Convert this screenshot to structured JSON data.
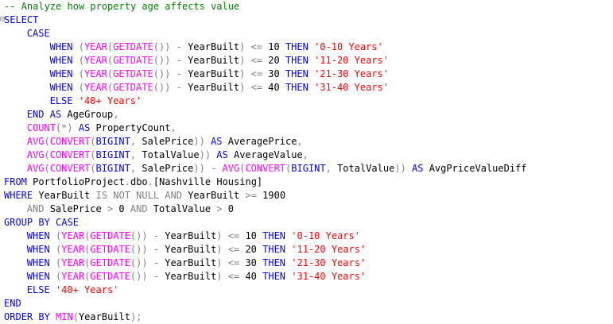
{
  "editor": {
    "language": "SQL",
    "colors": {
      "keyword": "#0000ff",
      "function": "#ff00ff",
      "string": "#ff0000",
      "comment": "#008000",
      "operator": "#808080",
      "identifier": "#000000"
    },
    "lines": [
      {
        "indent": 0,
        "tokens": [
          {
            "t": "cmt",
            "v": "-- Analyze how property age affects value"
          }
        ]
      },
      {
        "indent": 0,
        "collapse": true,
        "tokens": [
          {
            "t": "kw",
            "v": "SELECT"
          }
        ]
      },
      {
        "indent": 4,
        "tokens": [
          {
            "t": "kw",
            "v": "CASE"
          }
        ]
      },
      {
        "indent": 8,
        "tokens": [
          {
            "t": "kw",
            "v": "WHEN"
          },
          {
            "t": "id",
            "v": " "
          },
          {
            "t": "op",
            "v": "("
          },
          {
            "t": "fn",
            "v": "YEAR"
          },
          {
            "t": "op",
            "v": "("
          },
          {
            "t": "fn",
            "v": "GETDATE"
          },
          {
            "t": "op",
            "v": "())"
          },
          {
            "t": "id",
            "v": " "
          },
          {
            "t": "op",
            "v": "-"
          },
          {
            "t": "id",
            "v": " YearBuilt"
          },
          {
            "t": "op",
            "v": ")"
          },
          {
            "t": "id",
            "v": " "
          },
          {
            "t": "op",
            "v": "<="
          },
          {
            "t": "id",
            "v": " 10 "
          },
          {
            "t": "kw",
            "v": "THEN"
          },
          {
            "t": "id",
            "v": " "
          },
          {
            "t": "str",
            "v": "'0-10 Years'"
          }
        ]
      },
      {
        "indent": 8,
        "tokens": [
          {
            "t": "kw",
            "v": "WHEN"
          },
          {
            "t": "id",
            "v": " "
          },
          {
            "t": "op",
            "v": "("
          },
          {
            "t": "fn",
            "v": "YEAR"
          },
          {
            "t": "op",
            "v": "("
          },
          {
            "t": "fn",
            "v": "GETDATE"
          },
          {
            "t": "op",
            "v": "())"
          },
          {
            "t": "id",
            "v": " "
          },
          {
            "t": "op",
            "v": "-"
          },
          {
            "t": "id",
            "v": " YearBuilt"
          },
          {
            "t": "op",
            "v": ")"
          },
          {
            "t": "id",
            "v": " "
          },
          {
            "t": "op",
            "v": "<="
          },
          {
            "t": "id",
            "v": " 20 "
          },
          {
            "t": "kw",
            "v": "THEN"
          },
          {
            "t": "id",
            "v": " "
          },
          {
            "t": "str",
            "v": "'11-20 Years'"
          }
        ]
      },
      {
        "indent": 8,
        "tokens": [
          {
            "t": "kw",
            "v": "WHEN"
          },
          {
            "t": "id",
            "v": " "
          },
          {
            "t": "op",
            "v": "("
          },
          {
            "t": "fn",
            "v": "YEAR"
          },
          {
            "t": "op",
            "v": "("
          },
          {
            "t": "fn",
            "v": "GETDATE"
          },
          {
            "t": "op",
            "v": "())"
          },
          {
            "t": "id",
            "v": " "
          },
          {
            "t": "op",
            "v": "-"
          },
          {
            "t": "id",
            "v": " YearBuilt"
          },
          {
            "t": "op",
            "v": ")"
          },
          {
            "t": "id",
            "v": " "
          },
          {
            "t": "op",
            "v": "<="
          },
          {
            "t": "id",
            "v": " 30 "
          },
          {
            "t": "kw",
            "v": "THEN"
          },
          {
            "t": "id",
            "v": " "
          },
          {
            "t": "str",
            "v": "'21-30 Years'"
          }
        ]
      },
      {
        "indent": 8,
        "tokens": [
          {
            "t": "kw",
            "v": "WHEN"
          },
          {
            "t": "id",
            "v": " "
          },
          {
            "t": "op",
            "v": "("
          },
          {
            "t": "fn",
            "v": "YEAR"
          },
          {
            "t": "op",
            "v": "("
          },
          {
            "t": "fn",
            "v": "GETDATE"
          },
          {
            "t": "op",
            "v": "())"
          },
          {
            "t": "id",
            "v": " "
          },
          {
            "t": "op",
            "v": "-"
          },
          {
            "t": "id",
            "v": " YearBuilt"
          },
          {
            "t": "op",
            "v": ")"
          },
          {
            "t": "id",
            "v": " "
          },
          {
            "t": "op",
            "v": "<="
          },
          {
            "t": "id",
            "v": " 40 "
          },
          {
            "t": "kw",
            "v": "THEN"
          },
          {
            "t": "id",
            "v": " "
          },
          {
            "t": "str",
            "v": "'31-40 Years'"
          }
        ]
      },
      {
        "indent": 8,
        "tokens": [
          {
            "t": "kw",
            "v": "ELSE"
          },
          {
            "t": "id",
            "v": " "
          },
          {
            "t": "str",
            "v": "'40+ Years'"
          }
        ]
      },
      {
        "indent": 4,
        "tokens": [
          {
            "t": "kw",
            "v": "END"
          },
          {
            "t": "id",
            "v": " "
          },
          {
            "t": "kw",
            "v": "AS"
          },
          {
            "t": "id",
            "v": " AgeGroup"
          },
          {
            "t": "op",
            "v": ","
          }
        ]
      },
      {
        "indent": 4,
        "tokens": [
          {
            "t": "fn",
            "v": "COUNT"
          },
          {
            "t": "op",
            "v": "(*)"
          },
          {
            "t": "id",
            "v": " "
          },
          {
            "t": "kw",
            "v": "AS"
          },
          {
            "t": "id",
            "v": " PropertyCount"
          },
          {
            "t": "op",
            "v": ","
          }
        ]
      },
      {
        "indent": 4,
        "tokens": [
          {
            "t": "fn",
            "v": "AVG"
          },
          {
            "t": "op",
            "v": "("
          },
          {
            "t": "fn",
            "v": "CONVERT"
          },
          {
            "t": "op",
            "v": "("
          },
          {
            "t": "kw",
            "v": "BIGINT"
          },
          {
            "t": "op",
            "v": ","
          },
          {
            "t": "id",
            "v": " SalePrice"
          },
          {
            "t": "op",
            "v": "))"
          },
          {
            "t": "id",
            "v": " "
          },
          {
            "t": "kw",
            "v": "AS"
          },
          {
            "t": "id",
            "v": " AveragePrice"
          },
          {
            "t": "op",
            "v": ","
          }
        ]
      },
      {
        "indent": 4,
        "tokens": [
          {
            "t": "fn",
            "v": "AVG"
          },
          {
            "t": "op",
            "v": "("
          },
          {
            "t": "fn",
            "v": "CONVERT"
          },
          {
            "t": "op",
            "v": "("
          },
          {
            "t": "kw",
            "v": "BIGINT"
          },
          {
            "t": "op",
            "v": ","
          },
          {
            "t": "id",
            "v": " TotalValue"
          },
          {
            "t": "op",
            "v": "))"
          },
          {
            "t": "id",
            "v": " "
          },
          {
            "t": "kw",
            "v": "AS"
          },
          {
            "t": "id",
            "v": " AverageValue"
          },
          {
            "t": "op",
            "v": ","
          }
        ]
      },
      {
        "indent": 4,
        "tokens": [
          {
            "t": "fn",
            "v": "AVG"
          },
          {
            "t": "op",
            "v": "("
          },
          {
            "t": "fn",
            "v": "CONVERT"
          },
          {
            "t": "op",
            "v": "("
          },
          {
            "t": "kw",
            "v": "BIGINT"
          },
          {
            "t": "op",
            "v": ","
          },
          {
            "t": "id",
            "v": " SalePrice"
          },
          {
            "t": "op",
            "v": "))"
          },
          {
            "t": "id",
            "v": " "
          },
          {
            "t": "op",
            "v": "-"
          },
          {
            "t": "id",
            "v": " "
          },
          {
            "t": "fn",
            "v": "AVG"
          },
          {
            "t": "op",
            "v": "("
          },
          {
            "t": "fn",
            "v": "CONVERT"
          },
          {
            "t": "op",
            "v": "("
          },
          {
            "t": "kw",
            "v": "BIGINT"
          },
          {
            "t": "op",
            "v": ","
          },
          {
            "t": "id",
            "v": " TotalValue"
          },
          {
            "t": "op",
            "v": "))"
          },
          {
            "t": "id",
            "v": " "
          },
          {
            "t": "kw",
            "v": "AS"
          },
          {
            "t": "id",
            "v": " AvgPriceValueDiff"
          }
        ]
      },
      {
        "indent": 0,
        "tokens": [
          {
            "t": "kw",
            "v": "FROM"
          },
          {
            "t": "id",
            "v": " PortfolioProject"
          },
          {
            "t": "op",
            "v": "."
          },
          {
            "t": "id",
            "v": "dbo"
          },
          {
            "t": "op",
            "v": "."
          },
          {
            "t": "id",
            "v": "[Nashville Housing]"
          }
        ]
      },
      {
        "indent": 0,
        "tokens": [
          {
            "t": "kw",
            "v": "WHERE"
          },
          {
            "t": "id",
            "v": " YearBuilt "
          },
          {
            "t": "op",
            "v": "IS NOT NULL AND"
          },
          {
            "t": "id",
            "v": " YearBuilt "
          },
          {
            "t": "op",
            "v": ">="
          },
          {
            "t": "id",
            "v": " 1900"
          }
        ]
      },
      {
        "indent": 4,
        "tokens": [
          {
            "t": "op",
            "v": "AND"
          },
          {
            "t": "id",
            "v": " SalePrice "
          },
          {
            "t": "op",
            "v": ">"
          },
          {
            "t": "id",
            "v": " 0 "
          },
          {
            "t": "op",
            "v": "AND"
          },
          {
            "t": "id",
            "v": " TotalValue "
          },
          {
            "t": "op",
            "v": ">"
          },
          {
            "t": "id",
            "v": " 0"
          }
        ]
      },
      {
        "indent": 0,
        "tokens": [
          {
            "t": "kw",
            "v": "GROUP BY CASE"
          }
        ]
      },
      {
        "indent": 4,
        "tokens": [
          {
            "t": "kw",
            "v": "WHEN"
          },
          {
            "t": "id",
            "v": " "
          },
          {
            "t": "op",
            "v": "("
          },
          {
            "t": "fn",
            "v": "YEAR"
          },
          {
            "t": "op",
            "v": "("
          },
          {
            "t": "fn",
            "v": "GETDATE"
          },
          {
            "t": "op",
            "v": "())"
          },
          {
            "t": "id",
            "v": " "
          },
          {
            "t": "op",
            "v": "-"
          },
          {
            "t": "id",
            "v": " YearBuilt"
          },
          {
            "t": "op",
            "v": ")"
          },
          {
            "t": "id",
            "v": " "
          },
          {
            "t": "op",
            "v": "<="
          },
          {
            "t": "id",
            "v": " 10 "
          },
          {
            "t": "kw",
            "v": "THEN"
          },
          {
            "t": "id",
            "v": " "
          },
          {
            "t": "str",
            "v": "'0-10 Years'"
          }
        ]
      },
      {
        "indent": 4,
        "tokens": [
          {
            "t": "kw",
            "v": "WHEN"
          },
          {
            "t": "id",
            "v": " "
          },
          {
            "t": "op",
            "v": "("
          },
          {
            "t": "fn",
            "v": "YEAR"
          },
          {
            "t": "op",
            "v": "("
          },
          {
            "t": "fn",
            "v": "GETDATE"
          },
          {
            "t": "op",
            "v": "())"
          },
          {
            "t": "id",
            "v": " "
          },
          {
            "t": "op",
            "v": "-"
          },
          {
            "t": "id",
            "v": " YearBuilt"
          },
          {
            "t": "op",
            "v": ")"
          },
          {
            "t": "id",
            "v": " "
          },
          {
            "t": "op",
            "v": "<="
          },
          {
            "t": "id",
            "v": " 20 "
          },
          {
            "t": "kw",
            "v": "THEN"
          },
          {
            "t": "id",
            "v": " "
          },
          {
            "t": "str",
            "v": "'11-20 Years'"
          }
        ]
      },
      {
        "indent": 4,
        "tokens": [
          {
            "t": "kw",
            "v": "WHEN"
          },
          {
            "t": "id",
            "v": " "
          },
          {
            "t": "op",
            "v": "("
          },
          {
            "t": "fn",
            "v": "YEAR"
          },
          {
            "t": "op",
            "v": "("
          },
          {
            "t": "fn",
            "v": "GETDATE"
          },
          {
            "t": "op",
            "v": "())"
          },
          {
            "t": "id",
            "v": " "
          },
          {
            "t": "op",
            "v": "-"
          },
          {
            "t": "id",
            "v": " YearBuilt"
          },
          {
            "t": "op",
            "v": ")"
          },
          {
            "t": "id",
            "v": " "
          },
          {
            "t": "op",
            "v": "<="
          },
          {
            "t": "id",
            "v": " 30 "
          },
          {
            "t": "kw",
            "v": "THEN"
          },
          {
            "t": "id",
            "v": " "
          },
          {
            "t": "str",
            "v": "'21-30 Years'"
          }
        ]
      },
      {
        "indent": 4,
        "tokens": [
          {
            "t": "kw",
            "v": "WHEN"
          },
          {
            "t": "id",
            "v": " "
          },
          {
            "t": "op",
            "v": "("
          },
          {
            "t": "fn",
            "v": "YEAR"
          },
          {
            "t": "op",
            "v": "("
          },
          {
            "t": "fn",
            "v": "GETDATE"
          },
          {
            "t": "op",
            "v": "())"
          },
          {
            "t": "id",
            "v": " "
          },
          {
            "t": "op",
            "v": "-"
          },
          {
            "t": "id",
            "v": " YearBuilt"
          },
          {
            "t": "op",
            "v": ")"
          },
          {
            "t": "id",
            "v": " "
          },
          {
            "t": "op",
            "v": "<="
          },
          {
            "t": "id",
            "v": " 40 "
          },
          {
            "t": "kw",
            "v": "THEN"
          },
          {
            "t": "id",
            "v": " "
          },
          {
            "t": "str",
            "v": "'31-40 Years'"
          }
        ]
      },
      {
        "indent": 4,
        "tokens": [
          {
            "t": "kw",
            "v": "ELSE"
          },
          {
            "t": "id",
            "v": " "
          },
          {
            "t": "str",
            "v": "'40+ Years'"
          }
        ]
      },
      {
        "indent": 0,
        "tokens": [
          {
            "t": "kw",
            "v": "END"
          }
        ]
      },
      {
        "indent": 0,
        "tokens": [
          {
            "t": "kw",
            "v": "ORDER BY"
          },
          {
            "t": "id",
            "v": " "
          },
          {
            "t": "fn",
            "v": "MIN"
          },
          {
            "t": "op",
            "v": "("
          },
          {
            "t": "id",
            "v": "YearBuilt"
          },
          {
            "t": "op",
            "v": ");"
          }
        ]
      }
    ]
  }
}
